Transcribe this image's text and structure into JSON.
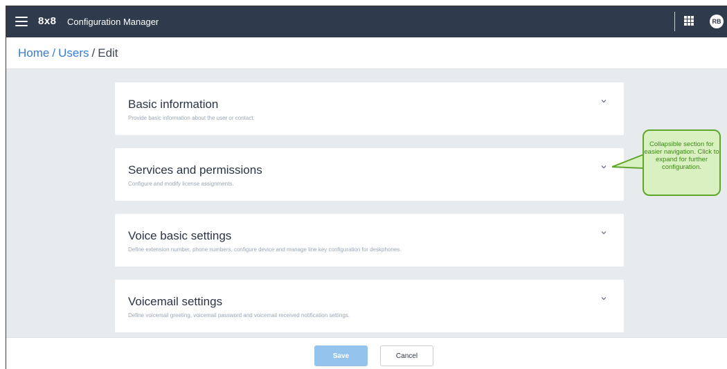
{
  "header": {
    "logo": "8x8",
    "app_title": "Configuration Manager",
    "avatar_initials": "RB",
    "bg_color": "#2f3a4d"
  },
  "breadcrumb": {
    "home": "Home",
    "users": "Users",
    "separator": "/",
    "current": "Edit"
  },
  "sections": [
    {
      "title": "Basic information",
      "description": "Provide basic information about the user or contact."
    },
    {
      "title": "Services and permissions",
      "description": "Configure and modify license assignments."
    },
    {
      "title": "Voice basic settings",
      "description": "Define extension number, phone numbers, configure device and manage line key configuration for deskphones."
    },
    {
      "title": "Voicemail settings",
      "description": "Define voicemail greeting, voicemail password and voicemail received notification settings."
    }
  ],
  "callout": {
    "text": "Collapsible section for easier navigation. Click to expand for further configuration."
  },
  "footer": {
    "save_label": "Save",
    "cancel_label": "Cancel"
  },
  "icons": [
    "hamburger-menu-icon",
    "app-grid-icon",
    "chevron-down-icon"
  ]
}
